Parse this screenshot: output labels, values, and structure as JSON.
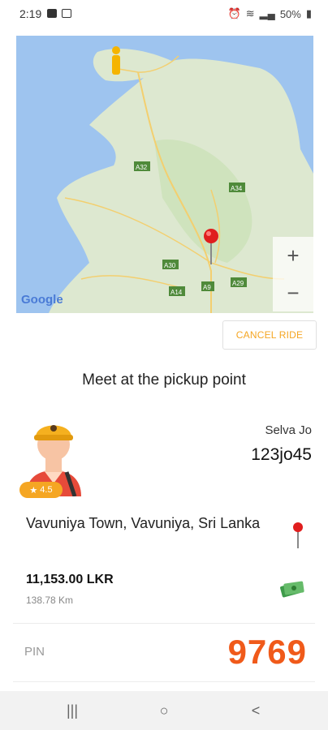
{
  "status_bar": {
    "time": "2:19",
    "battery": "50%"
  },
  "map": {
    "zoom_in": "+",
    "zoom_out": "−",
    "google_logo": "Google",
    "roads": [
      "A32",
      "A34",
      "A30",
      "A9",
      "A29",
      "A14"
    ]
  },
  "ride": {
    "cancel_label": "CANCEL RIDE",
    "status_message": "Meet at the pickup point",
    "driver": {
      "rating": "4.5",
      "name": "Selva Jo",
      "vehicle_no": "123jo45"
    },
    "address": "Vavuniya Town, Vavuniya, Sri Lanka",
    "fare": "11,153.00 LKR",
    "distance": "138.78 Km",
    "pin_label": "PIN",
    "pin_value": "9769"
  },
  "colors": {
    "accent": "#f5a623",
    "pin": "#f05a1a",
    "water": "#9ec4ef",
    "land": "#dde8d0"
  },
  "nav": {
    "recents": "|||",
    "home": "○",
    "back": "<"
  }
}
